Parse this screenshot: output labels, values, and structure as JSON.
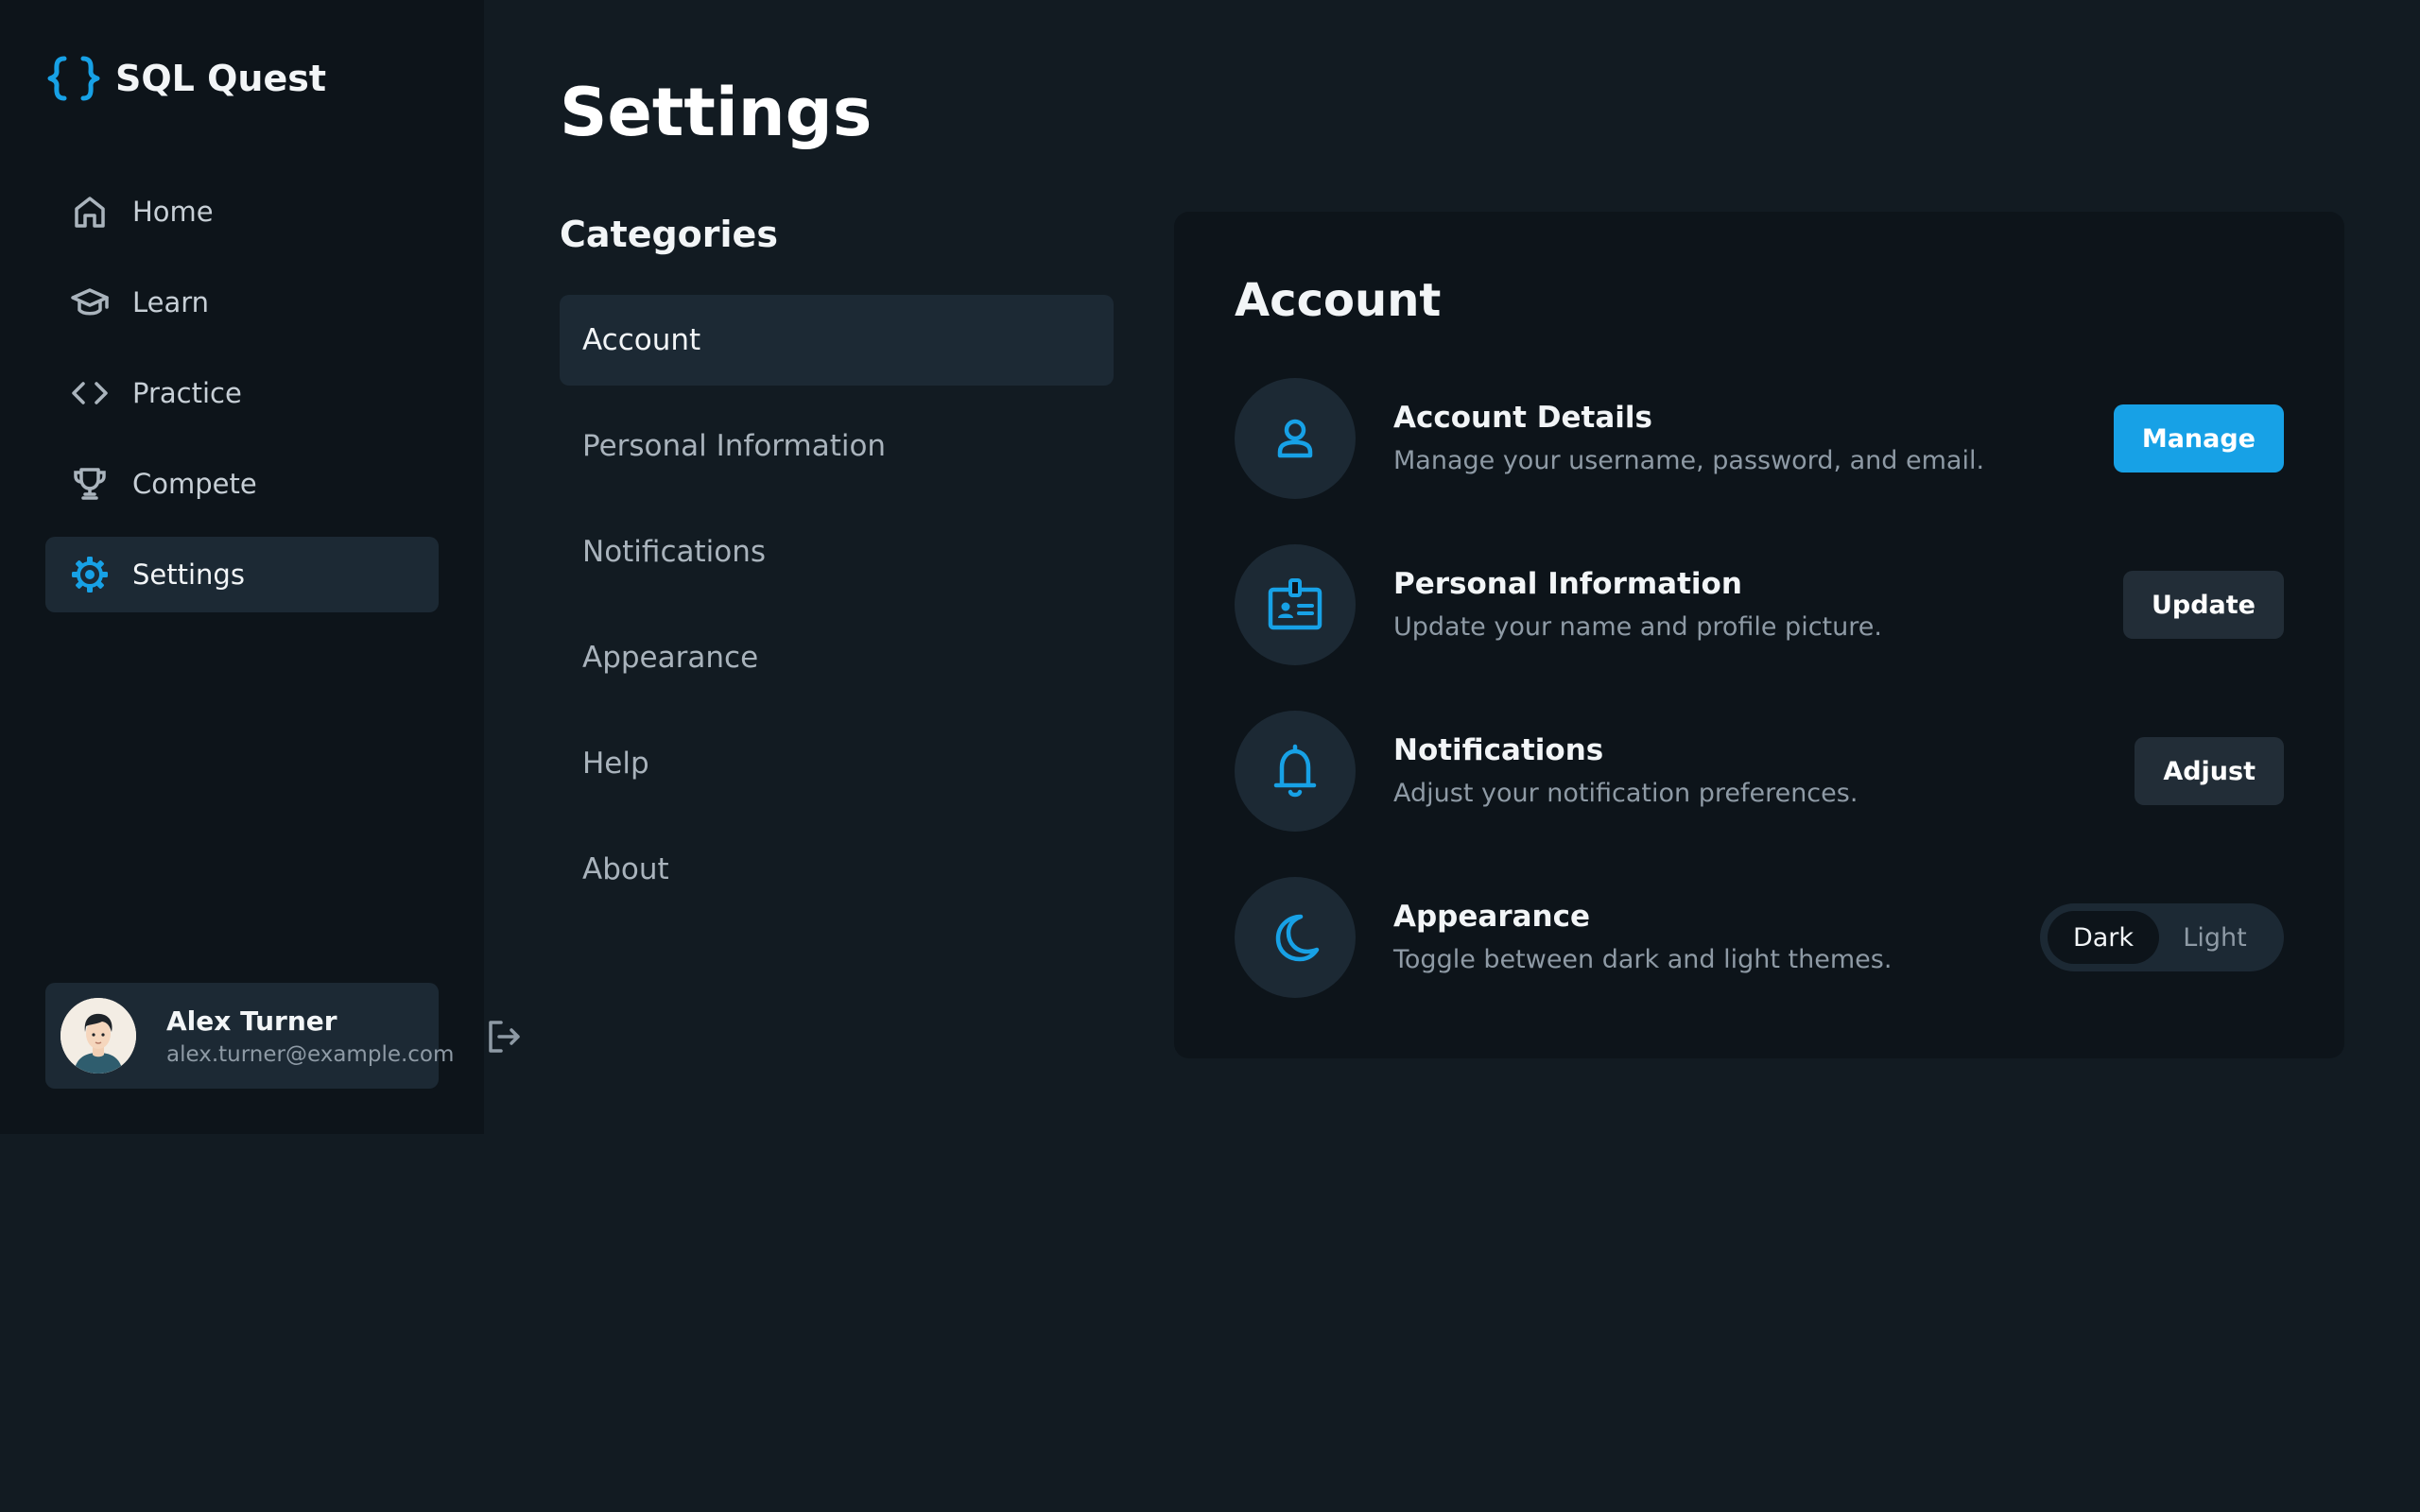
{
  "app": {
    "name": "SQL Quest",
    "accent_color": "#17a1e6",
    "logo_icon": "curly-braces-icon"
  },
  "sidebar": {
    "items": [
      {
        "label": "Home",
        "icon": "home-icon",
        "active": false
      },
      {
        "label": "Learn",
        "icon": "graduation-cap-icon",
        "active": false
      },
      {
        "label": "Practice",
        "icon": "code-icon",
        "active": false
      },
      {
        "label": "Compete",
        "icon": "trophy-icon",
        "active": false
      },
      {
        "label": "Settings",
        "icon": "gear-icon",
        "active": true
      }
    ],
    "user": {
      "name": "Alex Turner",
      "email": "alex.turner@example.com",
      "avatar_icon": "avatar-illustration"
    },
    "logout_icon": "logout-icon"
  },
  "page": {
    "title": "Settings"
  },
  "categories": {
    "heading": "Categories",
    "items": [
      {
        "label": "Account",
        "active": true
      },
      {
        "label": "Personal Information",
        "active": false
      },
      {
        "label": "Notifications",
        "active": false
      },
      {
        "label": "Appearance",
        "active": false
      },
      {
        "label": "Help",
        "active": false
      },
      {
        "label": "About",
        "active": false
      }
    ]
  },
  "panel": {
    "title": "Account",
    "rows": [
      {
        "icon": "user-icon",
        "title": "Account Details",
        "description": "Manage your username, password, and email.",
        "action": "Manage"
      },
      {
        "icon": "id-badge-icon",
        "title": "Personal Information",
        "description": "Update your name and profile picture.",
        "action": "Update"
      },
      {
        "icon": "bell-icon",
        "title": "Notifications",
        "description": "Adjust your notification preferences.",
        "action": "Adjust"
      },
      {
        "icon": "moon-icon",
        "title": "Appearance",
        "description": "Toggle between dark and light themes.",
        "toggle": {
          "options": [
            "Dark",
            "Light"
          ],
          "selected": "Dark"
        }
      }
    ]
  }
}
